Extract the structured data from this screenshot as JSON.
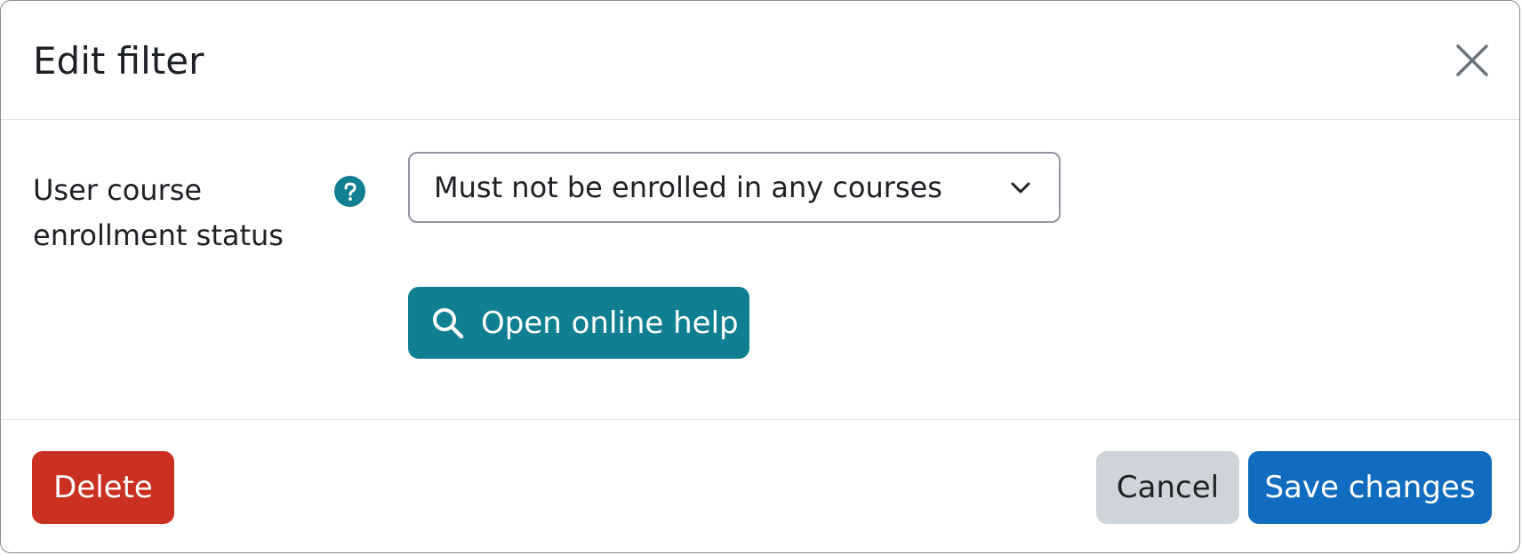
{
  "dialog": {
    "title": "Edit filter",
    "close_label": "Close"
  },
  "field": {
    "label": "User course enrollment status",
    "select_value": "Must not be enrolled in any courses"
  },
  "help_button": {
    "label": "Open online help"
  },
  "footer": {
    "delete_label": "Delete",
    "cancel_label": "Cancel",
    "save_label": "Save changes"
  },
  "colors": {
    "teal": "#0f7f91",
    "danger": "#ca3120",
    "primary": "#0f6cbf",
    "secondary": "#ced4da"
  }
}
